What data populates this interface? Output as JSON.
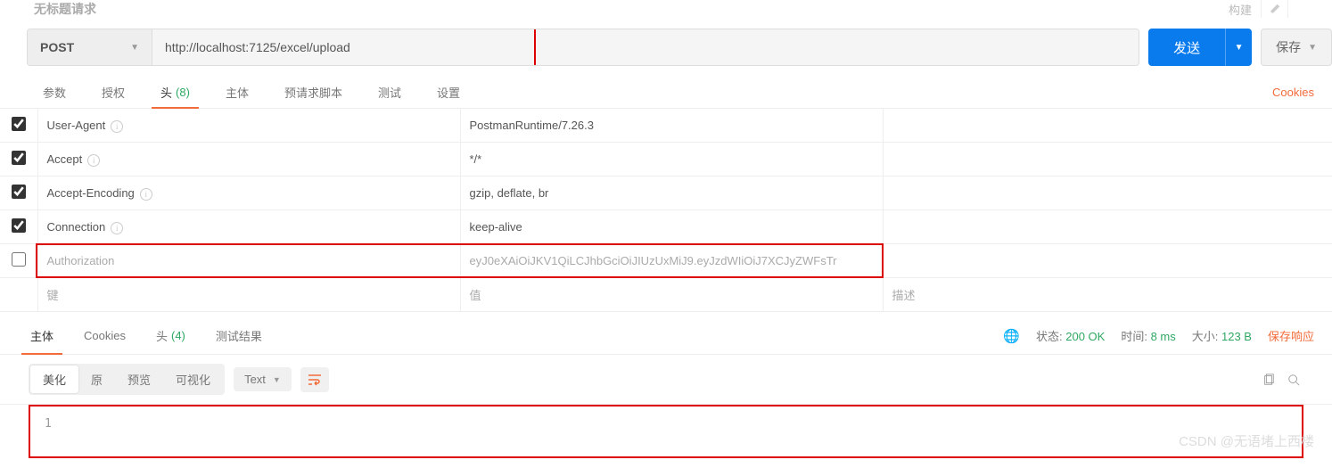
{
  "header": {
    "title": "无标题请求",
    "build": "构建"
  },
  "request": {
    "method": "POST",
    "url": "http://localhost:7125/excel/upload",
    "send": "发送",
    "save": "保存"
  },
  "req_tabs": {
    "items": [
      "参数",
      "授权",
      "头",
      "主体",
      "预请求脚本",
      "测试",
      "设置"
    ],
    "headers_count": "(8)",
    "cookies": "Cookies"
  },
  "headers": {
    "rows": [
      {
        "checked": true,
        "key": "User-Agent",
        "value": "PostmanRuntime/7.26.3",
        "info": true
      },
      {
        "checked": true,
        "key": "Accept",
        "value": "*/*",
        "info": true
      },
      {
        "checked": true,
        "key": "Accept-Encoding",
        "value": "gzip, deflate, br",
        "info": true
      },
      {
        "checked": true,
        "key": "Connection",
        "value": "keep-alive",
        "info": true
      }
    ],
    "auth": {
      "key": "Authorization",
      "value": "eyJ0eXAiOiJKV1QiLCJhbGciOiJIUzUxMiJ9.eyJzdWIiOiJ7XCJyZWFsTr"
    },
    "placeholder": {
      "key": "键",
      "value": "值",
      "desc": "描述"
    }
  },
  "resp_tabs": {
    "items": [
      "主体",
      "Cookies",
      "头",
      "测试结果"
    ],
    "headers_count": "(4)"
  },
  "resp_meta": {
    "status_label": "状态:",
    "status_value": "200 OK",
    "time_label": "时间:",
    "time_value": "8 ms",
    "size_label": "大小:",
    "size_value": "123 B",
    "save": "保存响应"
  },
  "body_toolbar": {
    "tabs": [
      "美化",
      "原",
      "预览",
      "可视化"
    ],
    "format": "Text"
  },
  "response_body": {
    "line1": "1"
  },
  "watermark": "CSDN @无语堵上西楼"
}
